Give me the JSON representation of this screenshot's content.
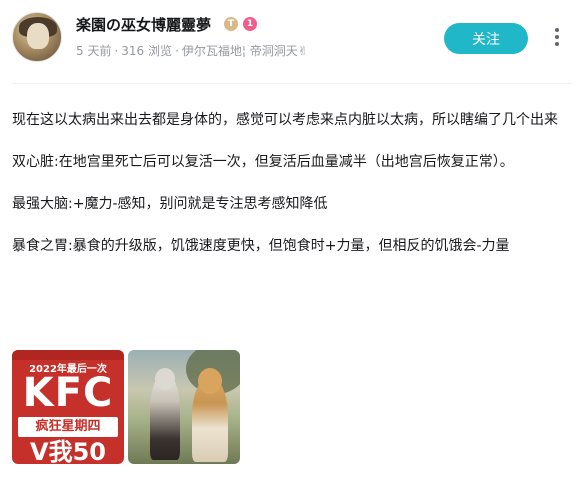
{
  "post": {
    "author": {
      "name": "楽園の巫女博麗靈夢",
      "badge_t": "T",
      "badge_level": "1"
    },
    "meta": {
      "time": "5 天前",
      "views": "316 浏览",
      "location": "伊尔瓦福地¦ 帝洞洞天✌"
    },
    "follow_label": "关注",
    "paragraphs": [
      "现在这以太病出来出去都是身体的，感觉可以考虑来点内脏以太病，所以瞎编了几个出来",
      "双心脏:在地宫里死亡后可以复活一次，但复活后血量减半（出地宫后恢复正常）。",
      "最强大脑:+魔力-感知，别问就是专注思考感知降低",
      "暴食之胃:暴食的升级版，饥饿速度更快，但饱食时+力量，但相反的饥饿会-力量"
    ],
    "images": [
      {
        "line1": "2022年最后一次",
        "line2": "KFC",
        "line3": "疯狂星期四",
        "line4": "V我50"
      },
      {
        "description_icon": "anime-illustration"
      }
    ]
  },
  "colors": {
    "accent": "#20b7c9",
    "meta_text": "#9499a0",
    "kfc_red": "#c6302a"
  }
}
